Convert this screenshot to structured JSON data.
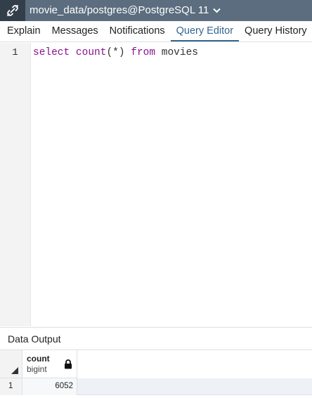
{
  "topbar": {
    "connection_label": "movie_data/postgres@PostgreSQL 11",
    "connection_icon": "plug-icon",
    "dropdown_icon": "chevron-down-icon"
  },
  "tabs": [
    {
      "label": "Explain"
    },
    {
      "label": "Messages"
    },
    {
      "label": "Notifications"
    },
    {
      "label": "Query Editor",
      "active": true
    },
    {
      "label": "Query History"
    }
  ],
  "editor": {
    "line_number": "1",
    "tokens": {
      "select": "select",
      "count": "count",
      "paren": "(*)",
      "from": "from",
      "table": "movies"
    }
  },
  "output": {
    "panel_title": "Data Output",
    "columns": [
      {
        "name": "count",
        "type": "bigint",
        "icon": "lock-icon"
      }
    ],
    "rows": [
      {
        "row_number": "1",
        "values": [
          "6052"
        ]
      }
    ]
  },
  "colors": {
    "topbar_bg": "#5b6d7f",
    "topbar_icon_bg": "#323e4a",
    "active_tab": "#326690",
    "keyword": "#8b0f93"
  }
}
